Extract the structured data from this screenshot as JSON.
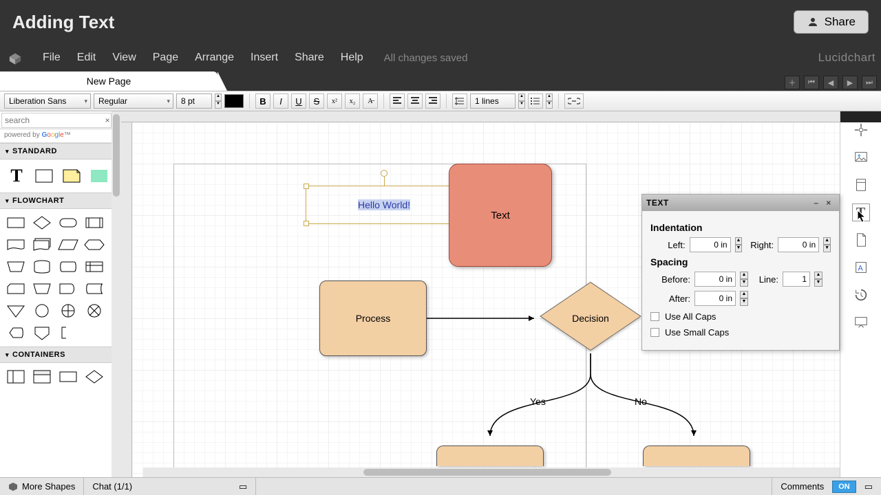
{
  "title": "Adding Text",
  "share_label": "Share",
  "menu": [
    "File",
    "Edit",
    "View",
    "Page",
    "Arrange",
    "Insert",
    "Share",
    "Help"
  ],
  "save_status": "All changes saved",
  "brand": "Lucidchart",
  "page_tab": "New Page",
  "format": {
    "font": "Liberation Sans",
    "weight": "Regular",
    "size": "8 pt",
    "lineheight": "1 lines"
  },
  "left": {
    "search_placeholder": "search",
    "cat_standard": "STANDARD",
    "cat_flowchart": "FLOWCHART",
    "cat_containers": "CONTAINERS"
  },
  "canvas": {
    "hello": "Hello World!",
    "textnode": "Text",
    "process": "Process",
    "decision": "Decision",
    "yes": "Yes",
    "no": "No"
  },
  "text_panel": {
    "title": "TEXT",
    "indent_h": "Indentation",
    "left_l": "Left:",
    "left_v": "0 in",
    "right_l": "Right:",
    "right_v": "0 in",
    "spacing_h": "Spacing",
    "before_l": "Before:",
    "before_v": "0 in",
    "line_l": "Line:",
    "line_v": "1",
    "after_l": "After:",
    "after_v": "0 in",
    "allcaps": "Use All Caps",
    "smallcaps": "Use Small Caps"
  },
  "status": {
    "more": "More Shapes",
    "chat": "Chat (1/1)",
    "comments": "Comments",
    "on": "ON"
  }
}
